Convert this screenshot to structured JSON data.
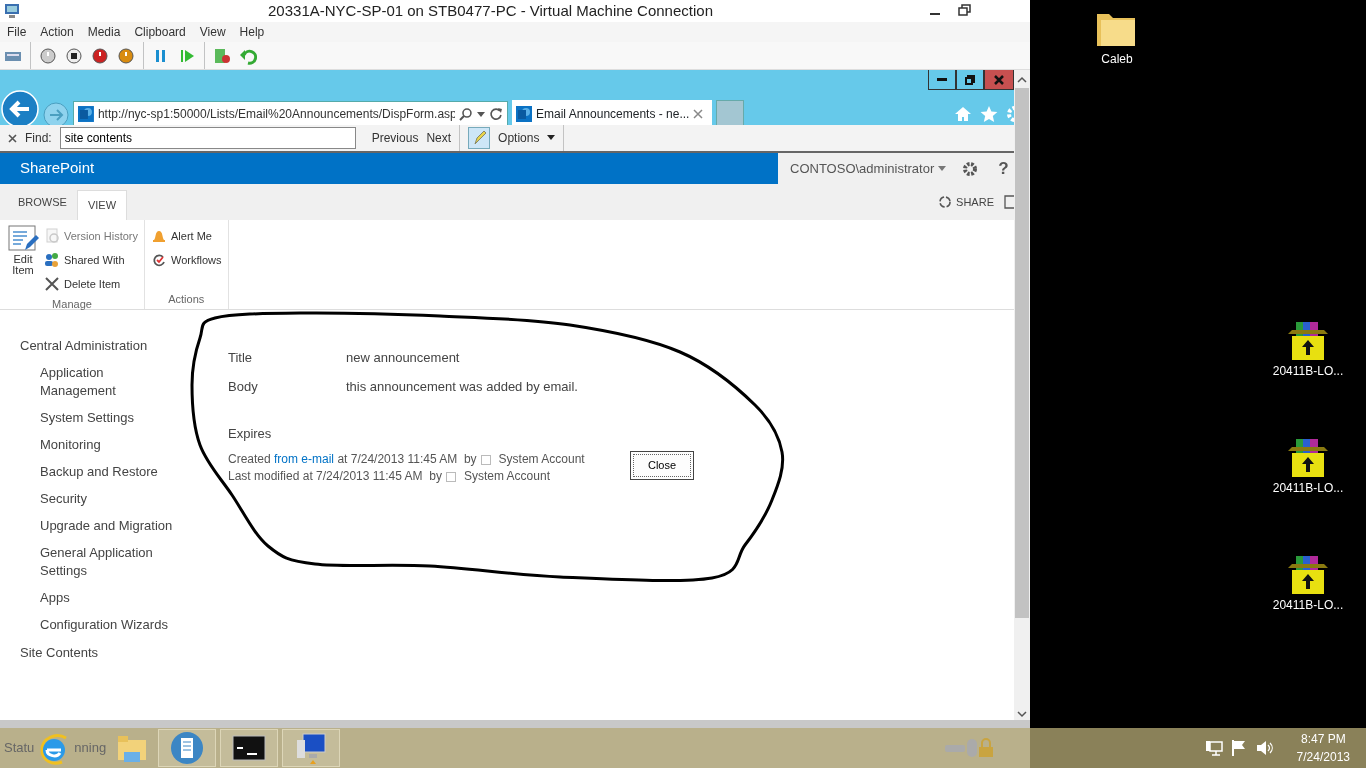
{
  "vm_window": {
    "title": "20331A-NYC-SP-01 on STB0477-PC - Virtual Machine Connection",
    "menu": [
      "File",
      "Action",
      "Media",
      "Clipboard",
      "View",
      "Help"
    ],
    "toolbar": [
      {
        "kind": "keys"
      },
      {
        "kind": "start"
      },
      {
        "kind": "turnoff"
      },
      {
        "kind": "shutdown"
      },
      {
        "kind": "save"
      },
      {
        "kind": "pause"
      },
      {
        "kind": "resume"
      },
      {
        "kind": "checkpoint"
      },
      {
        "kind": "revert"
      }
    ]
  },
  "browser": {
    "address": "http://nyc-sp1:50000/Lists/Email%20Announcements/DispForm.asp",
    "tabs": [
      {
        "label": "Email Announcements - ne...",
        "selected": true
      }
    ],
    "find": {
      "label": "Find:",
      "value": "site contents",
      "previous": "Previous",
      "next": "Next",
      "options": "Options"
    }
  },
  "sharepoint": {
    "brand": "SharePoint",
    "user": "CONTOSO\\administrator",
    "help": "?",
    "share": "SHARE",
    "ribbon_tabs": [
      {
        "label": "BROWSE",
        "selected": false
      },
      {
        "label": "VIEW",
        "selected": true
      }
    ],
    "ribbon_groups": [
      {
        "label": "Manage",
        "buttons": [
          {
            "kind": "large",
            "label": "Edit Item"
          },
          {
            "kind": "small",
            "label": "Version History",
            "disabled": true
          },
          {
            "kind": "small",
            "label": "Shared With",
            "disabled": false
          },
          {
            "kind": "small",
            "label": "Delete Item",
            "disabled": false
          }
        ]
      },
      {
        "label": "Actions",
        "buttons": [
          {
            "kind": "small",
            "label": "Alert Me",
            "disabled": false
          },
          {
            "kind": "small",
            "label": "Workflows",
            "disabled": false
          }
        ]
      }
    ],
    "nav": [
      {
        "label": "Central Administration",
        "children": [
          {
            "label": "Application Management"
          },
          {
            "label": "System Settings"
          },
          {
            "label": "Monitoring"
          },
          {
            "label": "Backup and Restore"
          },
          {
            "label": "Security"
          },
          {
            "label": "Upgrade and Migration"
          },
          {
            "label": "General Application Settings"
          },
          {
            "label": "Apps"
          },
          {
            "label": "Configuration Wizards"
          }
        ]
      },
      {
        "label": "Site Contents"
      }
    ],
    "form": {
      "fields": [
        {
          "label": "Title",
          "value": "new announcement"
        },
        {
          "label": "Body",
          "value": "this announcement was added by email."
        },
        {
          "label": "Expires"
        }
      ],
      "created": {
        "prefix": "Created",
        "link": "from e-mail",
        "suffix": "at 7/24/2013 11:45 AM  by",
        "user": "System Account"
      },
      "modified": {
        "text": "Last modified at 7/24/2013 11:45 AM  by",
        "user": "System Account"
      },
      "close": "Close"
    }
  },
  "status_bar": {
    "left": "Statu",
    "right": "nning"
  },
  "desktop_icons": [
    {
      "kind": "folder",
      "label": "Caleb"
    },
    {
      "kind": "archive",
      "label": "20411B-LO..."
    },
    {
      "kind": "archive",
      "label": "20411B-LO..."
    },
    {
      "kind": "archive",
      "label": "20411B-LO..."
    }
  ],
  "taskbar": {
    "apps": [
      {
        "kind": "ie",
        "open": false
      },
      {
        "kind": "explorer",
        "open": false
      },
      {
        "kind": "server",
        "open": true
      },
      {
        "kind": "cmd",
        "open": true
      },
      {
        "kind": "vm",
        "open": true
      }
    ],
    "clock": {
      "time": "8:47 PM",
      "date": "7/24/2013"
    }
  }
}
